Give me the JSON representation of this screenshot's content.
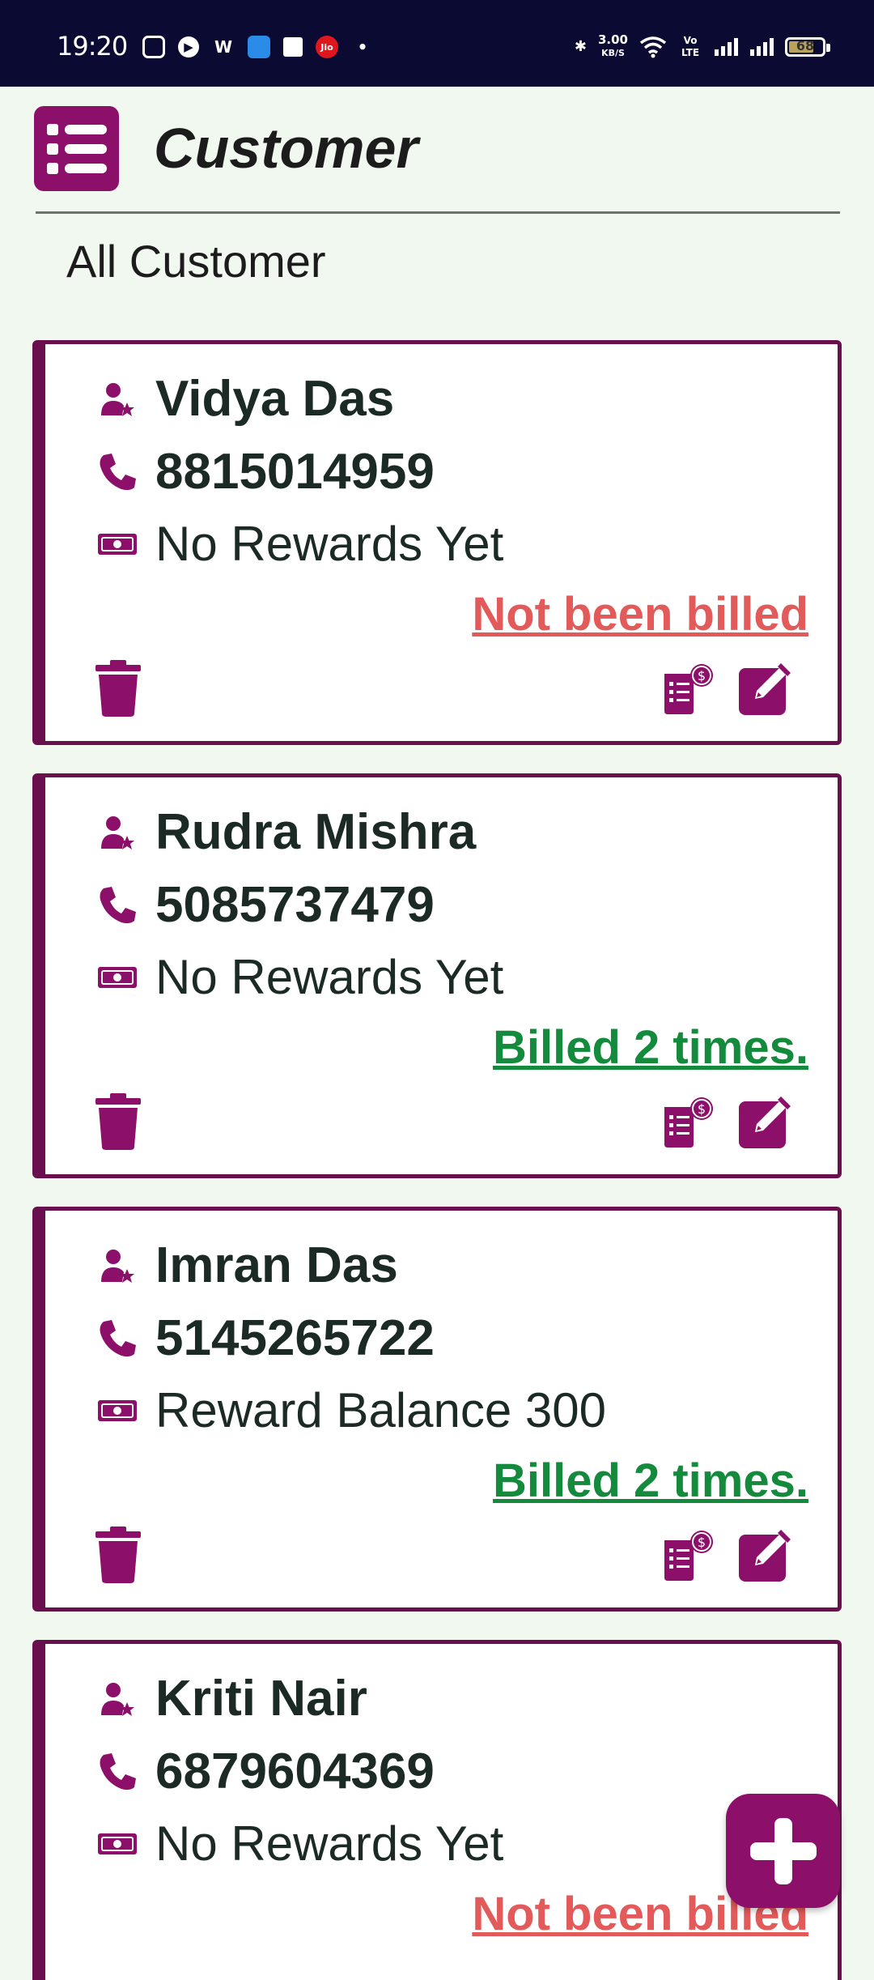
{
  "status_bar": {
    "time": "19:20",
    "net_speed_value": "3.00",
    "net_speed_unit": "KB/S",
    "volte": "Vo LTE",
    "battery": "68"
  },
  "header": {
    "title": "Customer",
    "menu_icon": "list-menu-icon"
  },
  "section": {
    "title": "All Customer"
  },
  "colors": {
    "brand": "#8c0f6a",
    "card_border": "#6a0f4e",
    "not_billed": "#e35a5a",
    "billed": "#138a3c",
    "background": "#f1f8ef"
  },
  "customers": [
    {
      "name": "Vidya Das",
      "phone": "8815014959",
      "reward": "No Rewards Yet",
      "bill_status": "Not been billed",
      "billed": false
    },
    {
      "name": "Rudra Mishra",
      "phone": "5085737479",
      "reward": "No Rewards Yet",
      "bill_status": "Billed 2 times.",
      "billed": true
    },
    {
      "name": "Imran Das",
      "phone": "5145265722",
      "reward": "Reward Balance 300",
      "bill_status": "Billed 2 times.",
      "billed": true
    },
    {
      "name": "Kriti Nair",
      "phone": "6879604369",
      "reward": "No Rewards Yet",
      "bill_status": "Not been billed",
      "billed": false
    }
  ],
  "fab": {
    "icon": "plus-icon"
  }
}
